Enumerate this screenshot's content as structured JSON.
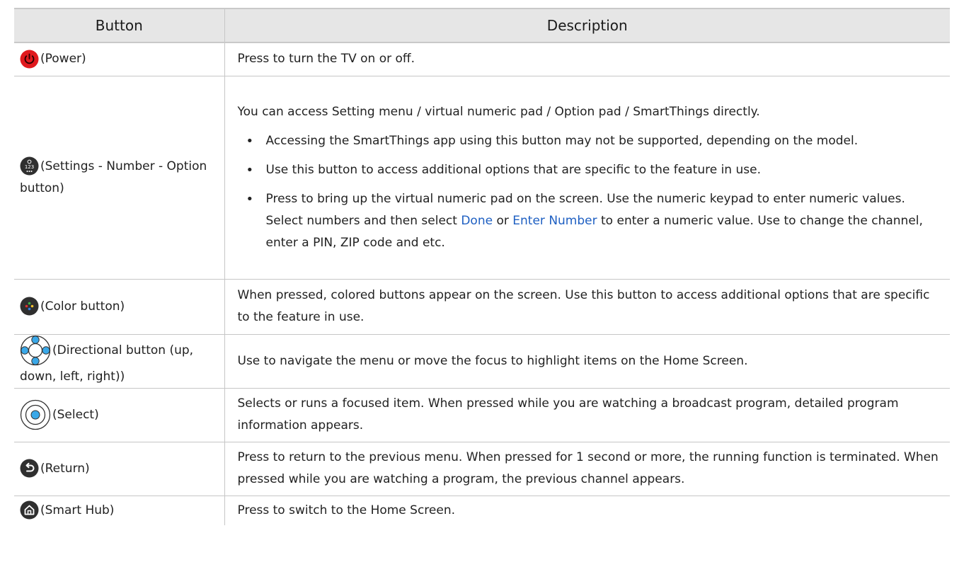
{
  "header": {
    "col_button": "Button",
    "col_description": "Description"
  },
  "rows": [
    {
      "button": "(Power)",
      "description": "Press to turn the TV on or off."
    },
    {
      "button": "(Settings - Number - Option button)",
      "description": "You can access Setting menu / virtual numeric pad / Option pad / SmartThings directly.",
      "bullets": [
        "Accessing the SmartThings app using this button may not be supported, depending on the model.",
        "Use this button to access additional options that are specific to the feature in use."
      ],
      "bullet3_part1": "Press to bring up the virtual numeric pad on the screen. Use the numeric keypad to enter numeric values. Select numbers and then select ",
      "bullet3_link1": "Done",
      "bullet3_part2": " or ",
      "bullet3_link2": "Enter Number",
      "bullet3_part3": " to enter a numeric value. Use to change the channel, enter a PIN, ZIP code and etc."
    },
    {
      "button": "(Color button)",
      "description": "When pressed, colored buttons appear on the screen. Use this button to access additional options that are specific to the feature in use."
    },
    {
      "button": "(Directional button (up, down, left, right))",
      "description": "Use to navigate the menu or move the focus to highlight items on the Home Screen."
    },
    {
      "button": "(Select)",
      "description": "Selects or runs a focused item. When pressed while you are watching a broadcast program, detailed program information appears."
    },
    {
      "button": "(Return)",
      "description": "Press to return to the previous menu. When pressed for 1 second or more, the running function is terminated. When pressed while you are watching a program, the previous channel appears."
    },
    {
      "button": "(Smart Hub)",
      "description": "Press to switch to the Home Screen."
    }
  ],
  "icons": [
    "power-icon",
    "settings-number-option-icon",
    "color-button-icon",
    "directional-pad-icon",
    "select-icon",
    "return-icon",
    "home-icon"
  ],
  "colors": {
    "power": "#e0191e",
    "link": "#1e5fc2",
    "dpad": "#3aa8e8",
    "icon_dark": "#2f2f2f",
    "header_bg": "#e6e6e6"
  }
}
